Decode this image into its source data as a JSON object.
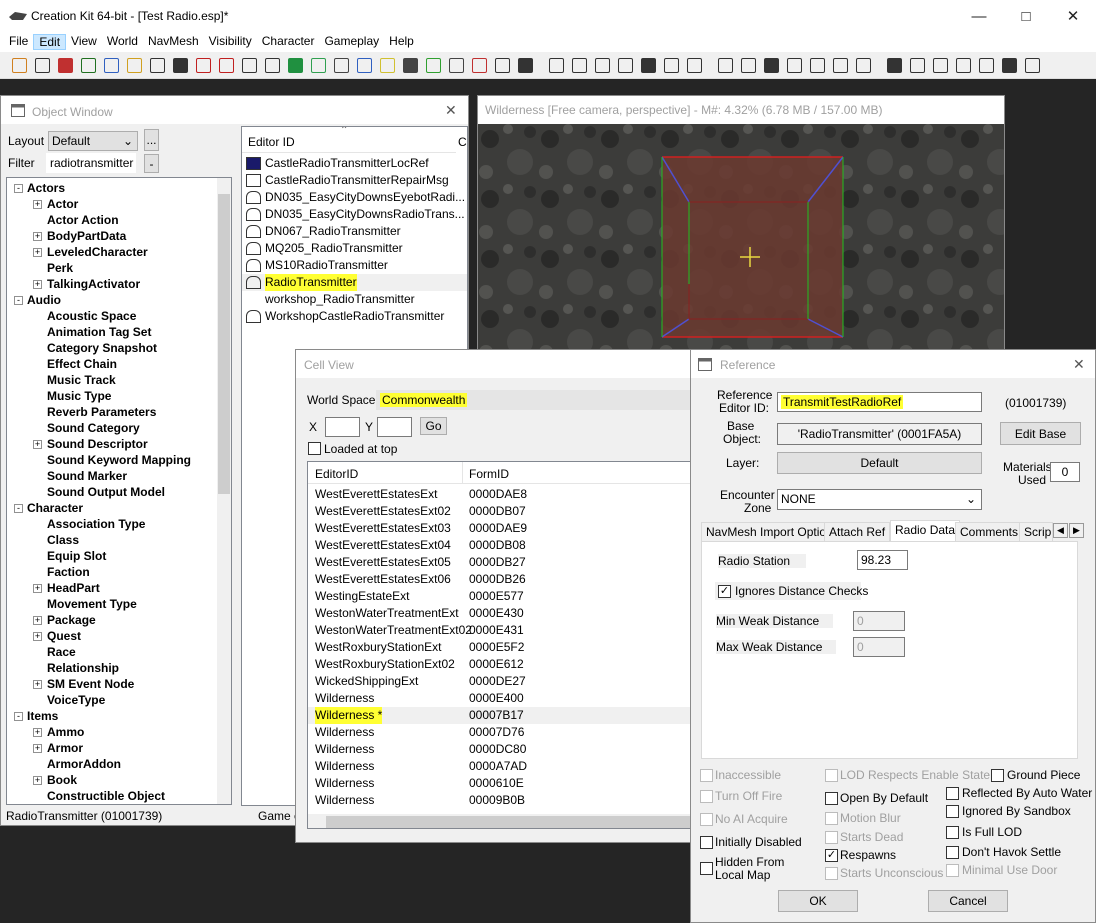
{
  "app": {
    "title": "Creation Kit 64-bit - [Test Radio.esp]*",
    "minimize_icon": "minimize-icon",
    "maximize_icon": "maximize-icon",
    "close_icon": "close-icon"
  },
  "menu": [
    "File",
    "Edit",
    "View",
    "World",
    "NavMesh",
    "Visibility",
    "Character",
    "Gameplay",
    "Help"
  ],
  "object_window": {
    "title": "Object Window",
    "layout_label": "Layout",
    "layout_value": "Default",
    "filter_label": "Filter",
    "filter_value": "radiotransmitter",
    "ellipsis": "...",
    "dash": "-",
    "col_editor_id": "Editor ID",
    "col_count_partial": "C",
    "tree": [
      {
        "label": "Actors",
        "level": 0,
        "exp": "-"
      },
      {
        "label": "Actor",
        "level": 1,
        "exp": "+"
      },
      {
        "label": "Actor Action",
        "level": 1,
        "exp": ""
      },
      {
        "label": "BodyPartData",
        "level": 1,
        "exp": "+"
      },
      {
        "label": "LeveledCharacter",
        "level": 1,
        "exp": "+"
      },
      {
        "label": "Perk",
        "level": 1,
        "exp": ""
      },
      {
        "label": "TalkingActivator",
        "level": 1,
        "exp": "+"
      },
      {
        "label": "Audio",
        "level": 0,
        "exp": "-"
      },
      {
        "label": "Acoustic Space",
        "level": 1,
        "exp": ""
      },
      {
        "label": "Animation Tag Set",
        "level": 1,
        "exp": ""
      },
      {
        "label": "Category Snapshot",
        "level": 1,
        "exp": ""
      },
      {
        "label": "Effect Chain",
        "level": 1,
        "exp": ""
      },
      {
        "label": "Music Track",
        "level": 1,
        "exp": ""
      },
      {
        "label": "Music Type",
        "level": 1,
        "exp": ""
      },
      {
        "label": "Reverb Parameters",
        "level": 1,
        "exp": ""
      },
      {
        "label": "Sound Category",
        "level": 1,
        "exp": ""
      },
      {
        "label": "Sound Descriptor",
        "level": 1,
        "exp": "+"
      },
      {
        "label": "Sound Keyword Mapping",
        "level": 1,
        "exp": ""
      },
      {
        "label": "Sound Marker",
        "level": 1,
        "exp": ""
      },
      {
        "label": "Sound Output Model",
        "level": 1,
        "exp": ""
      },
      {
        "label": "Character",
        "level": 0,
        "exp": "-"
      },
      {
        "label": "Association Type",
        "level": 1,
        "exp": ""
      },
      {
        "label": "Class",
        "level": 1,
        "exp": ""
      },
      {
        "label": "Equip Slot",
        "level": 1,
        "exp": ""
      },
      {
        "label": "Faction",
        "level": 1,
        "exp": ""
      },
      {
        "label": "HeadPart",
        "level": 1,
        "exp": "+"
      },
      {
        "label": "Movement Type",
        "level": 1,
        "exp": ""
      },
      {
        "label": "Package",
        "level": 1,
        "exp": "+"
      },
      {
        "label": "Quest",
        "level": 1,
        "exp": "+"
      },
      {
        "label": "Race",
        "level": 1,
        "exp": ""
      },
      {
        "label": "Relationship",
        "level": 1,
        "exp": ""
      },
      {
        "label": "SM Event Node",
        "level": 1,
        "exp": "+"
      },
      {
        "label": "VoiceType",
        "level": 1,
        "exp": ""
      },
      {
        "label": "Items",
        "level": 0,
        "exp": "-"
      },
      {
        "label": "Ammo",
        "level": 1,
        "exp": "+"
      },
      {
        "label": "Armor",
        "level": 1,
        "exp": "+"
      },
      {
        "label": "ArmorAddon",
        "level": 1,
        "exp": ""
      },
      {
        "label": "Book",
        "level": 1,
        "exp": "+"
      },
      {
        "label": "Constructible Object",
        "level": 1,
        "exp": ""
      }
    ],
    "objects": [
      {
        "id": "CastleRadioTransmitterLocRef",
        "icon": "location-ref-icon"
      },
      {
        "id": "CastleRadioTransmitterRepairMsg",
        "icon": "message-icon"
      },
      {
        "id": "DN035_EasyCityDownsEyebotRadi...",
        "icon": "radio-transmitter-icon"
      },
      {
        "id": "DN035_EasyCityDownsRadioTrans...",
        "icon": "radio-transmitter-icon"
      },
      {
        "id": "DN067_RadioTransmitter",
        "icon": "radio-transmitter-icon"
      },
      {
        "id": "MQ205_RadioTransmitter",
        "icon": "radio-transmitter-icon"
      },
      {
        "id": "MS10RadioTransmitter",
        "icon": "radio-transmitter-icon"
      },
      {
        "id": "RadioTransmitter",
        "icon": "radio-transmitter-icon"
      },
      {
        "id": "workshop_RadioTransmitter",
        "icon": ""
      },
      {
        "id": "WorkshopCastleRadioTransmitter",
        "icon": "radio-transmitter-icon"
      }
    ],
    "status": "RadioTransmitter (01001739)",
    "status2": "Game c"
  },
  "render_window": {
    "title": "Wilderness [Free camera, perspective] - M#: 4.32% (6.78 MB / 157.00 MB)"
  },
  "cell_view": {
    "title": "Cell View",
    "world_space_label": "World Space",
    "world_space_value": "Commonwealth",
    "x_label": "X",
    "y_label": "Y",
    "go_label": "Go",
    "loaded_label": "Loaded at top",
    "col_editor_id": "EditorID",
    "col_form_id": "FormID",
    "cells": [
      {
        "id": "WestEverettEstatesExt",
        "form": "0000DAE8"
      },
      {
        "id": "WestEverettEstatesExt02",
        "form": "0000DB07"
      },
      {
        "id": "WestEverettEstatesExt03",
        "form": "0000DAE9"
      },
      {
        "id": "WestEverettEstatesExt04",
        "form": "0000DB08"
      },
      {
        "id": "WestEverettEstatesExt05",
        "form": "0000DB27"
      },
      {
        "id": "WestEverettEstatesExt06",
        "form": "0000DB26"
      },
      {
        "id": "WestingEstateExt",
        "form": "0000E577"
      },
      {
        "id": "WestonWaterTreatmentExt",
        "form": "0000E430"
      },
      {
        "id": "WestonWaterTreatmentExt02",
        "form": "0000E431"
      },
      {
        "id": "WestRoxburyStationExt",
        "form": "0000E5F2"
      },
      {
        "id": "WestRoxburyStationExt02",
        "form": "0000E612"
      },
      {
        "id": "WickedShippingExt",
        "form": "0000DE27"
      },
      {
        "id": "Wilderness",
        "form": "0000E400"
      },
      {
        "id": "Wilderness *",
        "form": "00007B17"
      },
      {
        "id": "Wilderness",
        "form": "00007D76"
      },
      {
        "id": "Wilderness",
        "form": "0000DC80"
      },
      {
        "id": "Wilderness",
        "form": "0000A7AD"
      },
      {
        "id": "Wilderness",
        "form": "0000610E"
      },
      {
        "id": "Wilderness",
        "form": "00009B0B"
      }
    ]
  },
  "reference": {
    "title": "Reference",
    "ref_id_label_1": "Reference",
    "ref_id_label_2": "Editor ID:",
    "ref_id_value": "TransmitTestRadioRef",
    "form_id": "(01001739)",
    "base_label_1": "Base",
    "base_label_2": "Object:",
    "base_value": "'RadioTransmitter' (0001FA5A)",
    "edit_base": "Edit Base",
    "layer_label": "Layer:",
    "layer_value": "Default",
    "materials_label_1": "Materials",
    "materials_label_2": "Used",
    "materials_value": "0",
    "encounter_label_1": "Encounter",
    "encounter_label_2": "Zone",
    "encounter_value": "NONE",
    "tabs": [
      "NavMesh Import Option",
      "Attach Ref",
      "Radio Data",
      "Comments",
      "Scrip"
    ],
    "radio_station_label": "Radio Station",
    "radio_station_value": "98.23",
    "ignores_label": "Ignores Distance Checks",
    "min_weak_label": "Min Weak Distance",
    "min_weak_value": "0",
    "max_weak_label": "Max Weak Distance",
    "max_weak_value": "0",
    "flags": {
      "inaccessible": "Inaccessible",
      "turn_off_fire": "Turn Off Fire",
      "no_ai_acquire": "No AI Acquire",
      "initially_disabled": "Initially Disabled",
      "hidden_1": "Hidden From",
      "hidden_2": "Local Map",
      "lod_respects": "LOD Respects Enable State",
      "open_by_default": "Open By Default",
      "motion_blur": "Motion Blur",
      "starts_dead": "Starts Dead",
      "respawns": "Respawns",
      "starts_unconscious": "Starts Unconscious",
      "ground_piece": "Ground Piece",
      "reflected": "Reflected By Auto Water",
      "ignored_sandbox": "Ignored By Sandbox",
      "is_full_lod": "Is Full LOD",
      "dont_havok": "Don't Havok Settle",
      "minimal_use_door": "Minimal Use Door"
    },
    "ok": "OK",
    "cancel": "Cancel"
  }
}
